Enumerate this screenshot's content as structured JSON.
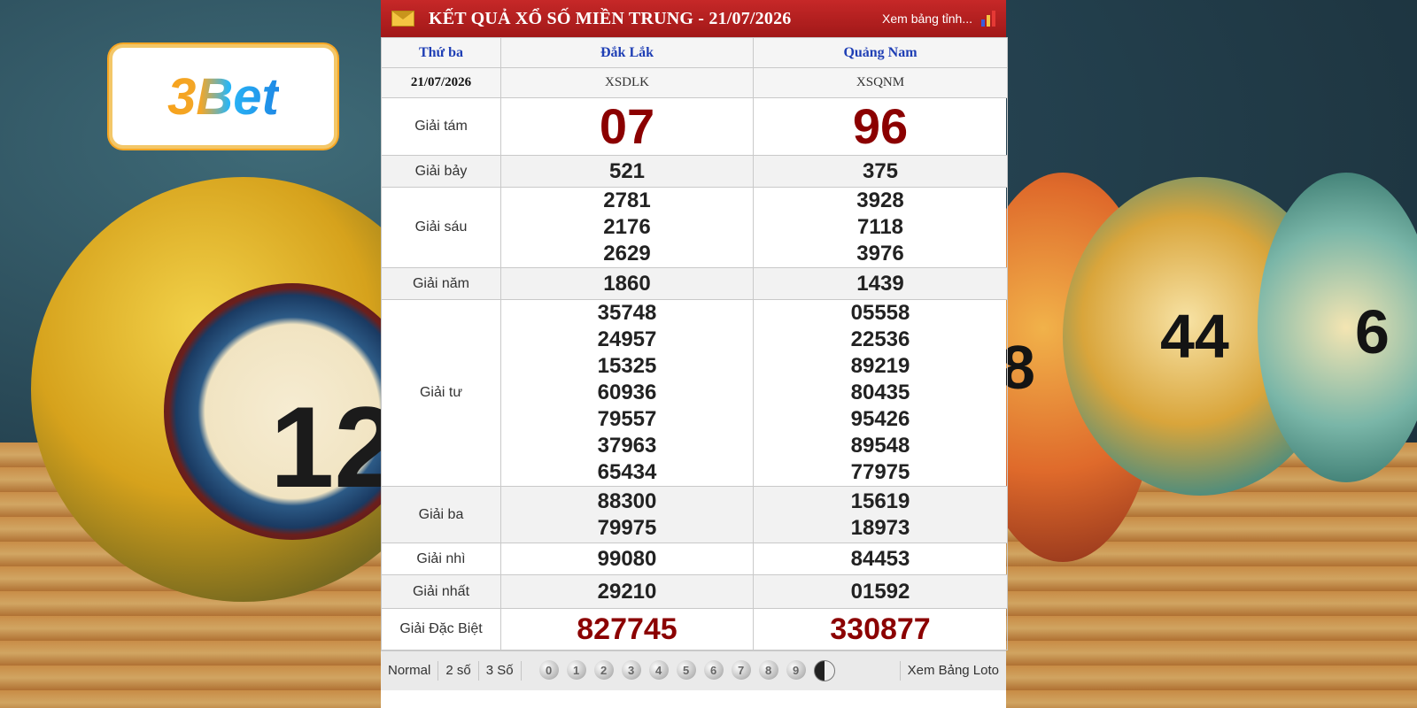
{
  "brand": {
    "logo_text": "3Bet"
  },
  "balls": {
    "big_number": "12",
    "right_numbers": [
      "8",
      "44",
      "6"
    ]
  },
  "header": {
    "title": "KẾT QUẢ XỔ SỐ MIỀN TRUNG - 21/07/2026",
    "view_link": "Xem bảng tỉnh...",
    "accent_color": "#b71c1c"
  },
  "table": {
    "day": "Thứ ba",
    "date": "21/07/2026",
    "provinces": [
      {
        "name": "Đắk Lắk",
        "code": "XSDLK"
      },
      {
        "name": "Quảng Nam",
        "code": "XSQNM"
      }
    ],
    "prizes": {
      "g8": {
        "label": "Giải tám",
        "values": [
          "07",
          "96"
        ]
      },
      "g7": {
        "label": "Giải bảy",
        "values": [
          "521",
          "375"
        ]
      },
      "g6": {
        "label": "Giải sáu",
        "values": [
          [
            "2781",
            "2176",
            "2629"
          ],
          [
            "3928",
            "7118",
            "3976"
          ]
        ]
      },
      "g5": {
        "label": "Giải năm",
        "values": [
          "1860",
          "1439"
        ]
      },
      "g4": {
        "label": "Giải tư",
        "values": [
          [
            "35748",
            "24957",
            "15325",
            "60936",
            "79557",
            "37963",
            "65434"
          ],
          [
            "05558",
            "22536",
            "89219",
            "80435",
            "95426",
            "89548",
            "77975"
          ]
        ]
      },
      "g3": {
        "label": "Giải ba",
        "values": [
          [
            "88300",
            "79975"
          ],
          [
            "15619",
            "18973"
          ]
        ]
      },
      "g2": {
        "label": "Giải nhì",
        "values": [
          "99080",
          "84453"
        ]
      },
      "g1": {
        "label": "Giải nhất",
        "values": [
          "29210",
          "01592"
        ]
      },
      "db": {
        "label": "Giải Đặc Biệt",
        "values": [
          "827745",
          "330877"
        ]
      }
    }
  },
  "footer": {
    "options": [
      "Normal",
      "2 số",
      "3 Số"
    ],
    "digits": [
      "0",
      "1",
      "2",
      "3",
      "4",
      "5",
      "6",
      "7",
      "8",
      "9"
    ],
    "loto_link": "Xem Bảng Loto"
  }
}
